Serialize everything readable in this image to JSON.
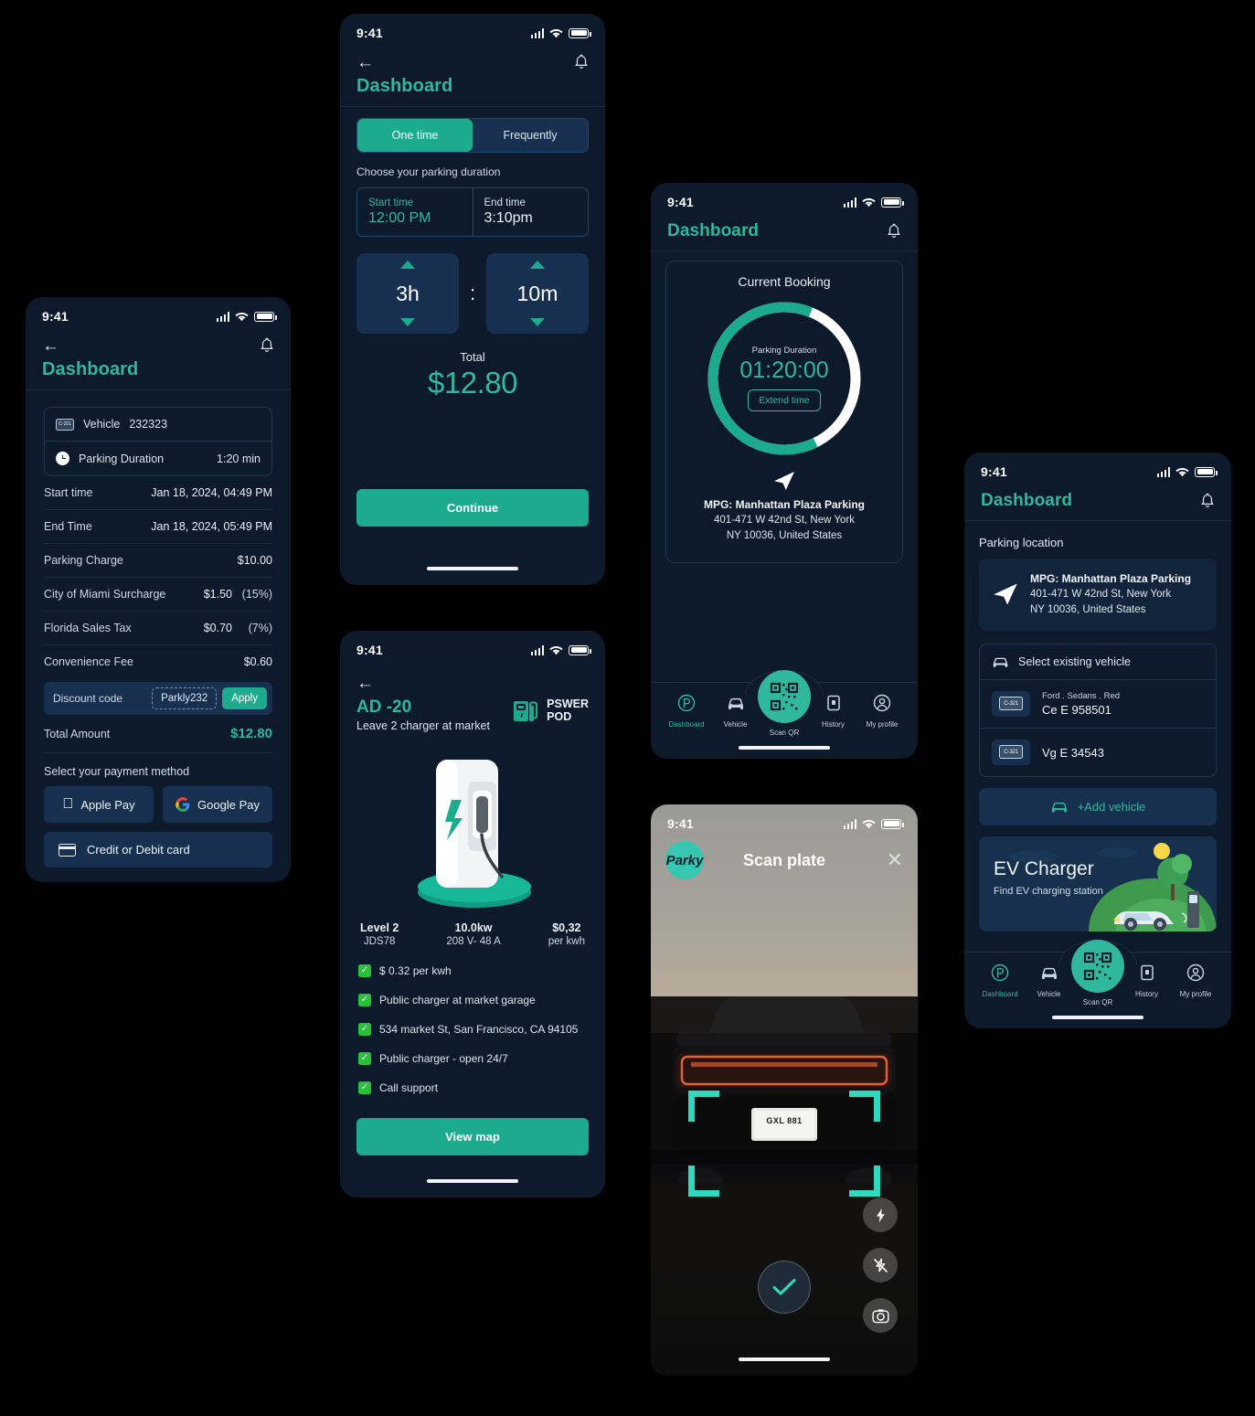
{
  "status": {
    "time": "9:41"
  },
  "receipt": {
    "title": "Dashboard",
    "vehicle_label": "Vehicle",
    "vehicle_value": "232323",
    "duration_label": "Parking Duration",
    "duration_value": "1:20 min",
    "rows": [
      {
        "label": "Start time",
        "value": "Jan 18, 2024, 04:49 PM",
        "pct": ""
      },
      {
        "label": "End Time",
        "value": "Jan 18, 2024, 05:49 PM",
        "pct": ""
      },
      {
        "label": "Parking Charge",
        "value": "$10.00",
        "pct": ""
      },
      {
        "label": "City of Miami Surcharge",
        "value": "$1.50",
        "pct": "(15%)"
      },
      {
        "label": "Florida Sales Tax",
        "value": "$0.70",
        "pct": "(7%)"
      },
      {
        "label": "Convenience Fee",
        "value": "$0.60",
        "pct": ""
      }
    ],
    "discount_label": "Discount code",
    "discount_code": "Parkly232",
    "apply_label": "Apply",
    "total_label": "Total Amount",
    "total_value": "$12.80",
    "payment_label": "Select your payment method",
    "apple_pay": "Apple Pay",
    "google_pay": "Google Pay",
    "credit_card": "Credit or Debit card"
  },
  "duration": {
    "title": "Dashboard",
    "tab_one": "One time",
    "tab_frequent": "Frequently",
    "choose_label": "Choose your parking duration",
    "start_label": "Start time",
    "start_value": "12:00 PM",
    "end_label": "End time",
    "end_value": "3:10pm",
    "hours": "3h",
    "separator": ":",
    "minutes": "10m",
    "total_label": "Total",
    "total_value": "$12.80",
    "continue_label": "Continue"
  },
  "charger": {
    "title": "AD -20",
    "subtitle": "Leave 2 charger at market",
    "brand_line1": "PSWER",
    "brand_line2": "POD",
    "specs": [
      {
        "top": "Level 2",
        "bottom": "JDS78"
      },
      {
        "top": "10.0kw",
        "bottom": "208 V- 48 A"
      },
      {
        "top": "$0,32",
        "bottom": "per kwh"
      }
    ],
    "features": [
      "$ 0.32 per kwh",
      "Public charger at market garage",
      "534 market St, San Francisco, CA 94105",
      "Public charger - open 24/7",
      "Call support"
    ],
    "view_map": "View map"
  },
  "booking": {
    "title": "Dashboard",
    "card_title": "Current Booking",
    "ring_label": "Parking Duration",
    "timer": "01:20:00",
    "extend_label": "Extend time",
    "addr_name": "MPG: Manhattan Plaza Parking",
    "addr_line1": "401-471 W 42nd St, New York",
    "addr_line2": "NY 10036, United States",
    "nav": [
      {
        "label": "Dashboard",
        "icon": "parking-p-icon",
        "active": true
      },
      {
        "label": "Vehicle",
        "icon": "car-icon",
        "active": false
      },
      {
        "label": "Scan QR",
        "icon": "qr-code-icon",
        "active": false
      },
      {
        "label": "History",
        "icon": "history-icon",
        "active": false
      },
      {
        "label": "My profile",
        "icon": "user-icon",
        "active": false
      }
    ]
  },
  "scan": {
    "logo": "Parky",
    "title": "Scan plate",
    "close_icon": "close-icon",
    "plate_text": "GXL 881",
    "flash_on_icon": "flash-on-icon",
    "flash_off_icon": "flash-off-icon",
    "camera_icon": "camera-icon",
    "confirm_icon": "check-icon"
  },
  "location": {
    "title": "Dashboard",
    "section_label": "Parking location",
    "addr_name": "MPG: Manhattan Plaza Parking",
    "addr_line1": "401-471 W 42nd St, New York",
    "addr_line2": "NY 10036, United States",
    "select_vehicle_label": "Select existing vehicle",
    "vehicles": [
      {
        "meta": "Ford . Sedans . Red",
        "plate": "Ce E 958501"
      },
      {
        "meta": "",
        "plate": "Vg E 34543"
      }
    ],
    "add_vehicle": "+Add vehicle",
    "ev_title": "EV Charger",
    "ev_sub": "Find EV charging station",
    "nav": [
      {
        "label": "Dashboard",
        "icon": "parking-p-icon",
        "active": true
      },
      {
        "label": "Vehicle",
        "icon": "car-icon",
        "active": false
      },
      {
        "label": "Scan QR",
        "icon": "qr-code-icon",
        "active": false
      },
      {
        "label": "History",
        "icon": "history-icon",
        "active": false
      },
      {
        "label": "My profile",
        "icon": "user-icon",
        "active": false
      }
    ]
  },
  "colors": {
    "accent": "#1dab8d",
    "accent_light": "#2fb89c",
    "background": "#0c1a2b",
    "card": "#17304f",
    "check_green": "#27c23a",
    "scan_corner": "#2fd9bd"
  }
}
